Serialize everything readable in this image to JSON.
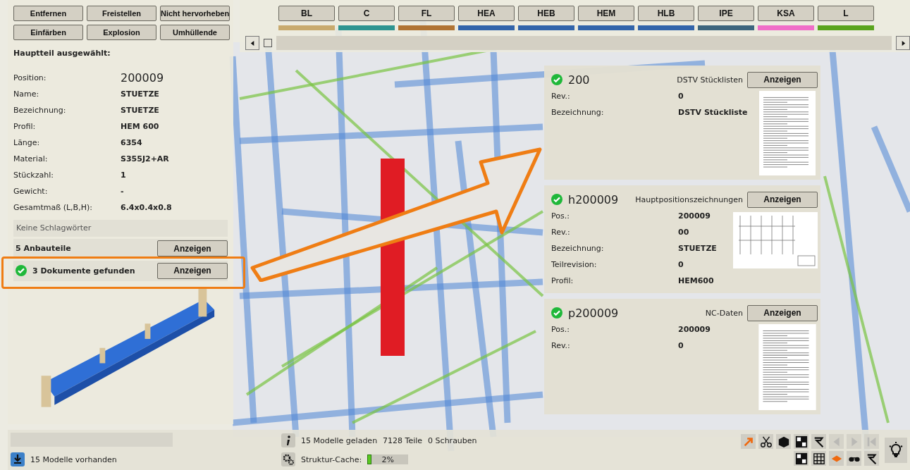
{
  "actions": [
    {
      "label": "Entfernen"
    },
    {
      "label": "Freistellen"
    },
    {
      "label": "Nicht hervorheben"
    },
    {
      "label": "Einfärben"
    },
    {
      "label": "Explosion"
    },
    {
      "label": "Umhüllende"
    }
  ],
  "profile_tabs": [
    {
      "label": "BL",
      "color": "#c8aa6e"
    },
    {
      "label": "C",
      "color": "#2e9490"
    },
    {
      "label": "FL",
      "color": "#b07434"
    },
    {
      "label": "HEA",
      "color": "#3264aa"
    },
    {
      "label": "HEB",
      "color": "#3264aa"
    },
    {
      "label": "HEM",
      "color": "#3264aa"
    },
    {
      "label": "HLB",
      "color": "#3264aa"
    },
    {
      "label": "IPE",
      "color": "#3e667e"
    },
    {
      "label": "KSA",
      "color": "#f06ec8"
    },
    {
      "label": "L",
      "color": "#5aa41e"
    }
  ],
  "part": {
    "heading": "Hauptteil ausgewählt:",
    "fields": [
      {
        "label": "Position:",
        "value": "200009",
        "kind": "large"
      },
      {
        "label": "Name:",
        "value": "STUETZE",
        "kind": "normal"
      },
      {
        "label": "Bezeichnung:",
        "value": "STUETZE",
        "kind": "normal"
      },
      {
        "label": "Profil:",
        "value": "HEM 600",
        "kind": "normal"
      },
      {
        "label": "Länge:",
        "value": "6354",
        "kind": "normal"
      },
      {
        "label": "Material:",
        "value": "S355J2+AR",
        "kind": "normal"
      },
      {
        "label": "Stückzahl:",
        "value": "1",
        "kind": "normal"
      },
      {
        "label": "Gewicht:",
        "value": "-",
        "kind": "normal"
      },
      {
        "label": "Gesamtmaß (L,B,H):",
        "value": "6.4x0.4x0.8",
        "kind": "normal"
      }
    ],
    "keywords": "Keine Schlagwörter",
    "attachments": {
      "text": "5 Anbauteile",
      "button": "Anzeigen"
    },
    "documents": {
      "text": "3 Dokumente gefunden",
      "button": "Anzeigen",
      "found": true
    }
  },
  "documents": [
    {
      "title": "200",
      "category": "DSTV Stücklisten",
      "button": "Anzeigen",
      "found": true,
      "kind": "list",
      "fields": [
        {
          "label": "Rev.:",
          "value": "0"
        },
        {
          "label": "Bezeichnung:",
          "value": "DSTV Stückliste"
        }
      ]
    },
    {
      "title": "h200009",
      "category": "Hauptpositionszeichnungen",
      "button": "Anzeigen",
      "found": true,
      "kind": "drawing",
      "fields": [
        {
          "label": "Pos.:",
          "value": "200009"
        },
        {
          "label": "Rev.:",
          "value": "00"
        },
        {
          "label": "Bezeichnung:",
          "value": "STUETZE"
        },
        {
          "label": "Teilrevision:",
          "value": "0"
        },
        {
          "label": "Profil:",
          "value": "HEM600"
        }
      ]
    },
    {
      "title": "p200009",
      "category": "NC-Daten",
      "button": "Anzeigen",
      "found": true,
      "kind": "list",
      "fields": [
        {
          "label": "Pos.:",
          "value": "200009"
        },
        {
          "label": "Rev.:",
          "value": "0"
        }
      ]
    }
  ],
  "status": {
    "models_available": "15 Modelle vorhanden",
    "models_loaded": "15 Modelle geladen",
    "parts": "7128 Teile",
    "bolts": "0 Schrauben",
    "cache_label": "Struktur-Cache:",
    "cache": {
      "level": 0.02,
      "reading": "2%"
    }
  },
  "toolbar": [
    {
      "kind": "arrow",
      "disabled": false
    },
    {
      "kind": "scissors",
      "disabled": false
    },
    {
      "kind": "cube",
      "disabled": false
    },
    {
      "kind": "axes",
      "disabled": false
    },
    {
      "kind": "flag",
      "disabled": false
    },
    {
      "kind": "prev",
      "disabled": true
    },
    {
      "kind": "next",
      "disabled": true
    },
    {
      "kind": "first",
      "disabled": true
    },
    {
      "kind": "axes",
      "disabled": false
    },
    {
      "kind": "grid",
      "disabled": false
    },
    {
      "kind": "plane",
      "disabled": false
    },
    {
      "kind": "glasses",
      "disabled": false
    },
    {
      "kind": "flag",
      "disabled": false
    }
  ]
}
